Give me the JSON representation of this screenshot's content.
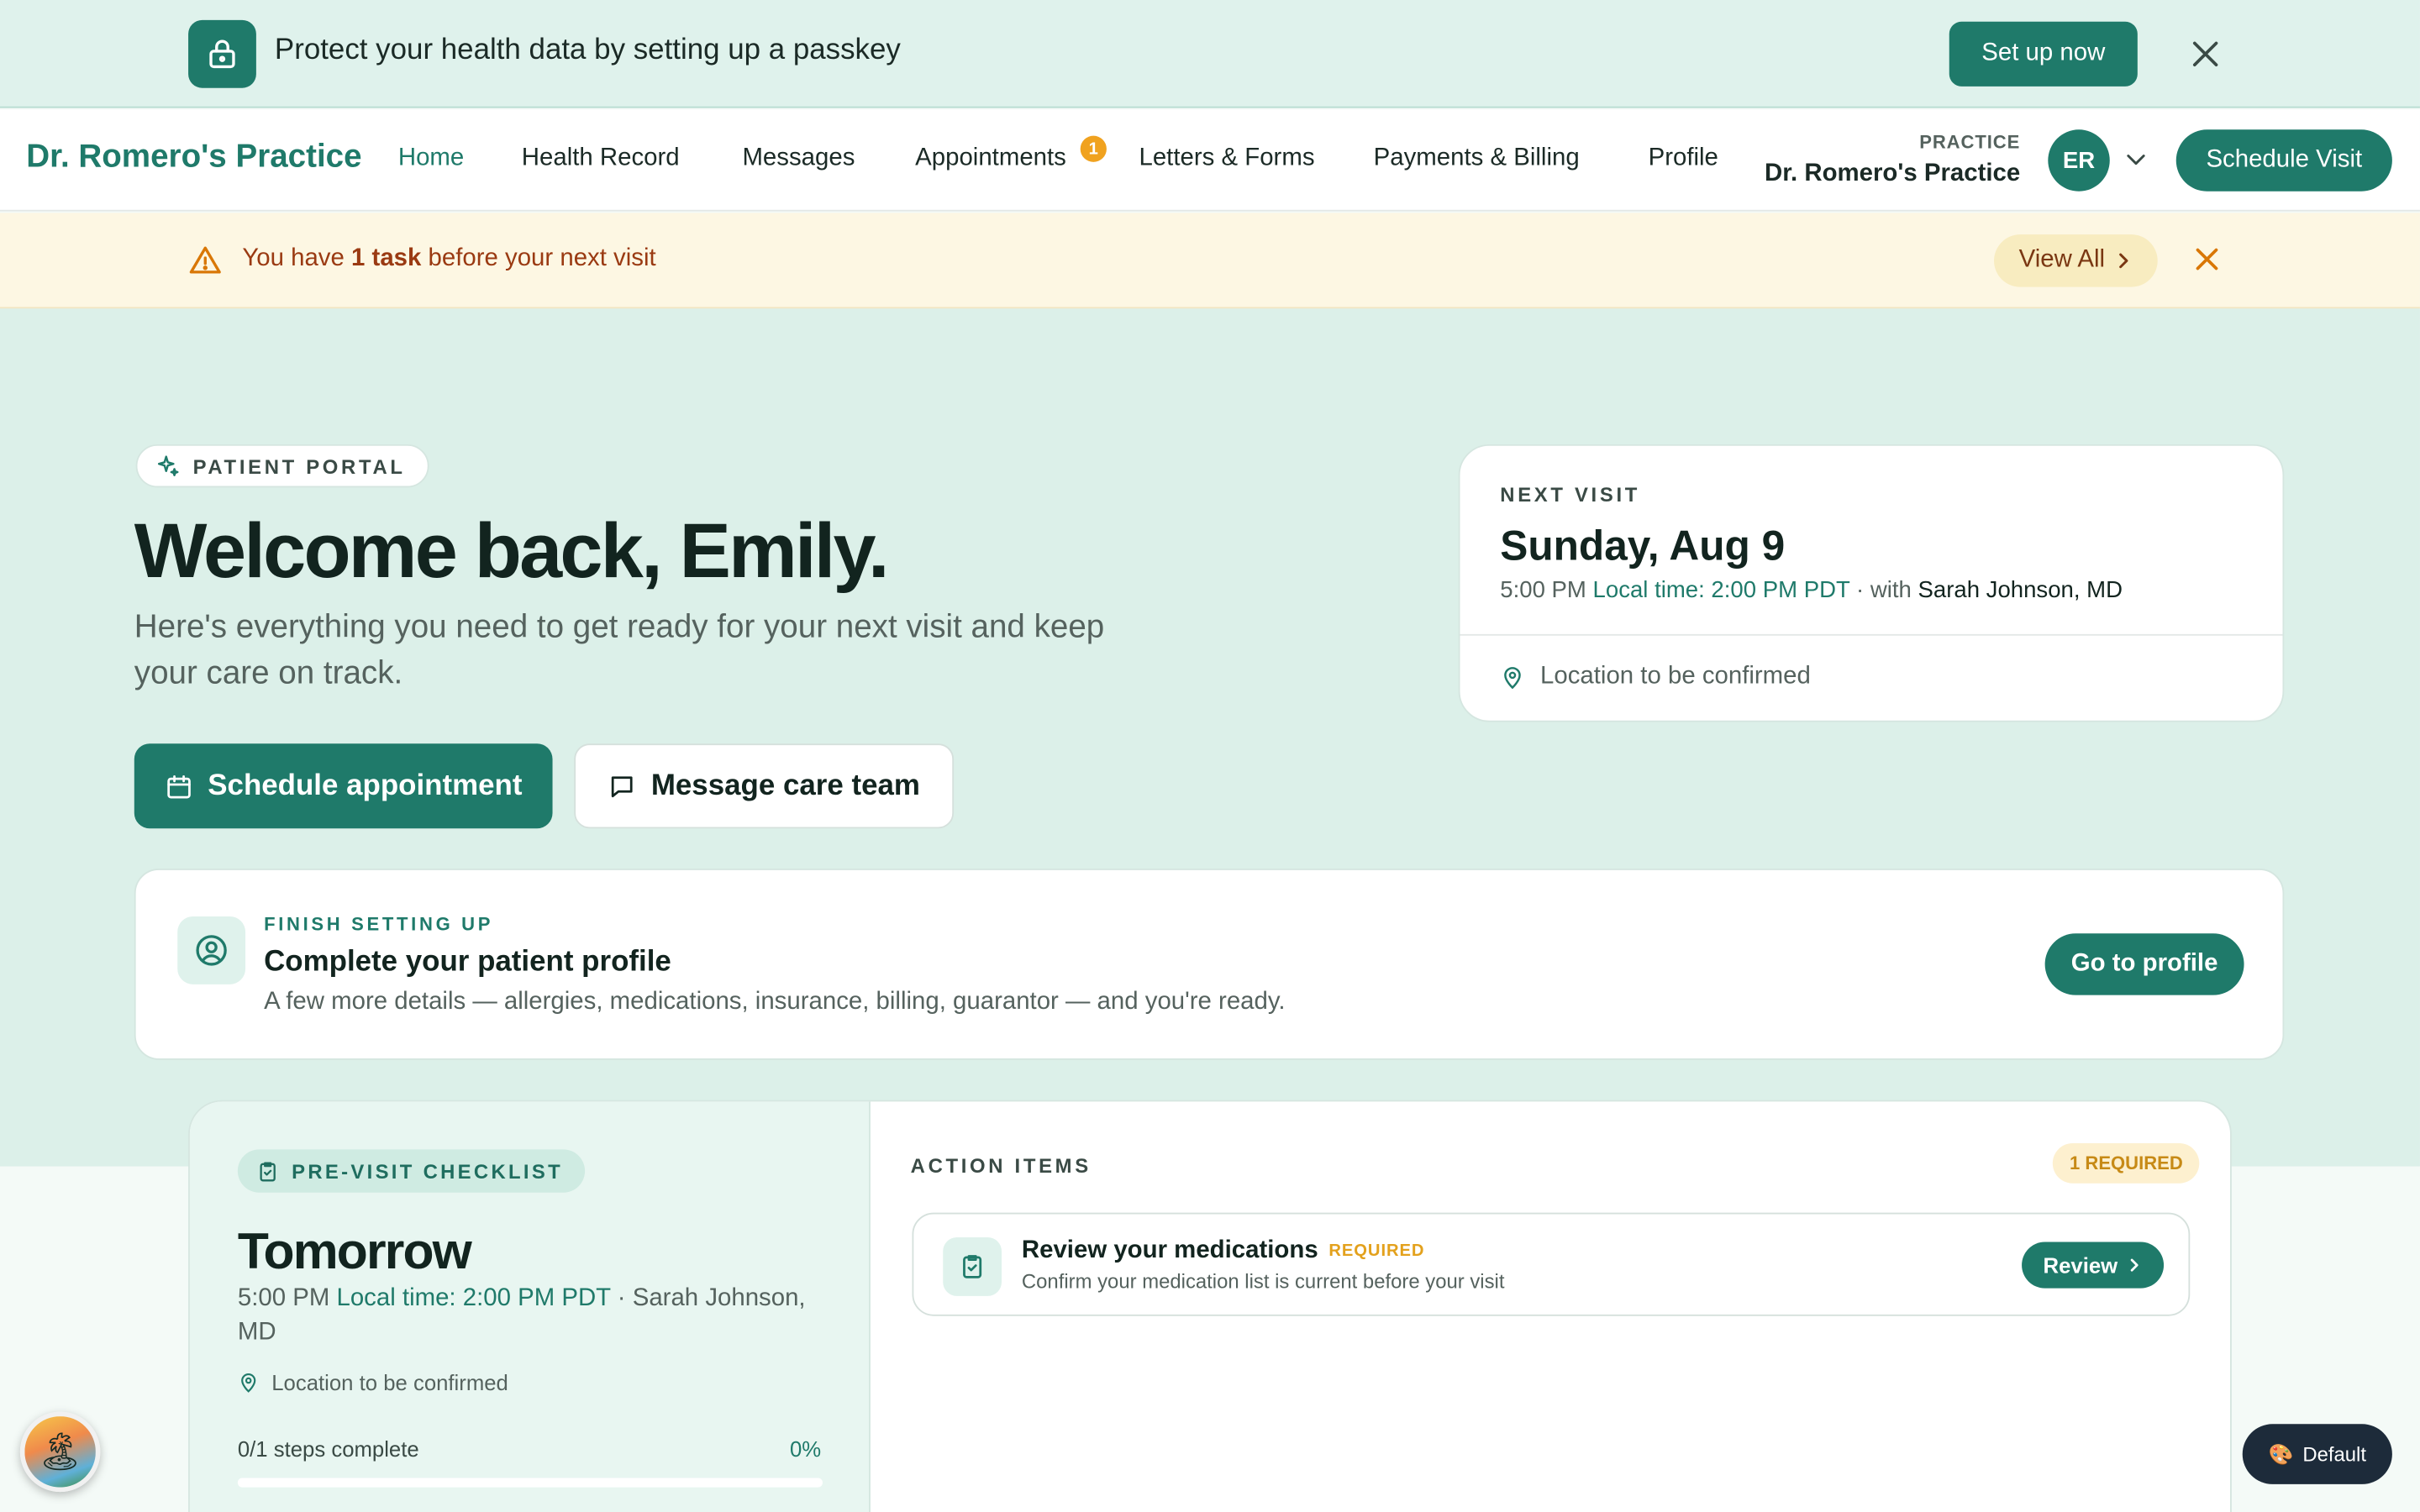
{
  "passkey_banner": {
    "text": "Protect your health data by setting up a passkey",
    "cta": "Set up now"
  },
  "nav": {
    "brand": "Dr. Romero's Practice",
    "items": [
      {
        "label": "Home",
        "active": true
      },
      {
        "label": "Health Record"
      },
      {
        "label": "Messages"
      },
      {
        "label": "Appointments",
        "badge": "1"
      },
      {
        "label": "Letters & Forms"
      },
      {
        "label": "Payments & Billing"
      },
      {
        "label": "Profile"
      }
    ],
    "practice_label": "PRACTICE",
    "practice_name": "Dr. Romero's Practice",
    "avatar_initials": "ER",
    "cta": "Schedule Visit"
  },
  "task_banner": {
    "prefix": "You have ",
    "bold": "1 task",
    "suffix": " before your next visit",
    "cta": "View All"
  },
  "hero": {
    "pill": "PATIENT PORTAL",
    "title": "Welcome back, Emily.",
    "subtitle": "Here's everything you need to get ready for your next visit and keep your care on track.",
    "primary_cta": "Schedule appointment",
    "secondary_cta": "Message care team"
  },
  "next_visit": {
    "label": "NEXT VISIT",
    "date": "Sunday, Aug 9",
    "time": "5:00 PM",
    "local_time": "Local time: 2:00 PM PDT",
    "with_prefix": "with",
    "doctor": "Sarah Johnson, MD",
    "location": "Location to be confirmed"
  },
  "setup_card": {
    "eyebrow": "FINISH SETTING UP",
    "title": "Complete your patient profile",
    "description": "A few more details — allergies, medications, insurance, billing, guarantor — and you're ready.",
    "cta": "Go to profile"
  },
  "checklist": {
    "pill": "PRE-VISIT CHECKLIST",
    "title": "Tomorrow",
    "time": "5:00 PM",
    "local_time": "Local time: 2:00 PM PDT",
    "doctor": "Sarah Johnson, MD",
    "location": "Location to be confirmed",
    "steps": "0/1 steps complete",
    "percent": "0%",
    "progress": 0,
    "action_items_label": "ACTION ITEMS",
    "required_count": "1 REQUIRED",
    "items": [
      {
        "title": "Review your medications",
        "tag": "REQUIRED",
        "description": "Confirm your medication list is current before your visit",
        "cta": "Review"
      }
    ]
  },
  "theme_pill": "Default",
  "colors": {
    "primary": "#1f7a6a",
    "hero_bg": "#dcf0e9",
    "warning": "#d97706",
    "warning_bg": "#fdf7e3"
  }
}
